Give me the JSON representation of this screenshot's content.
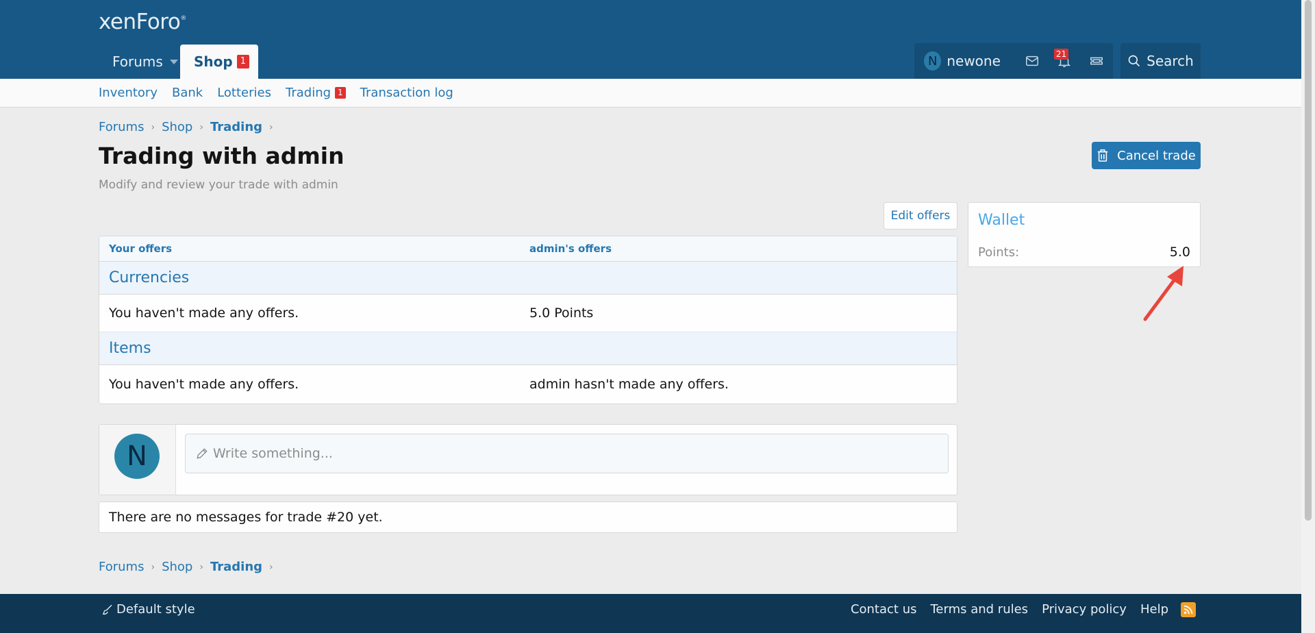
{
  "header": {
    "logo": "xenForo",
    "logo_mark": "®",
    "tabs": [
      {
        "label": "Forums"
      },
      {
        "label": "Shop",
        "badge": "1"
      }
    ],
    "user": {
      "initial": "N",
      "name": "newone"
    },
    "notifications_badge": "21",
    "search_label": "Search"
  },
  "subnav": {
    "items": [
      {
        "label": "Inventory"
      },
      {
        "label": "Bank"
      },
      {
        "label": "Lotteries"
      },
      {
        "label": "Trading",
        "badge": "1"
      },
      {
        "label": "Transaction log"
      }
    ]
  },
  "breadcrumb": {
    "items": [
      "Forums",
      "Shop",
      "Trading"
    ],
    "sep": "›"
  },
  "page": {
    "title": "Trading with admin",
    "description": "Modify and review your trade with admin",
    "cancel_label": "Cancel trade",
    "edit_label": "Edit offers"
  },
  "offers": {
    "headers": [
      "Your offers",
      "admin's offers"
    ],
    "sections": [
      {
        "title": "Currencies",
        "yours": "You haven't made any offers.",
        "theirs": "5.0 Points"
      },
      {
        "title": "Items",
        "yours": "You haven't made any offers.",
        "theirs": "admin hasn't made any offers."
      }
    ]
  },
  "wallet": {
    "title": "Wallet",
    "label": "Points:",
    "value": "5.0"
  },
  "composer": {
    "avatar_initial": "N",
    "placeholder": "Write something..."
  },
  "messages": {
    "empty_text": "There are no messages for trade #20 yet."
  },
  "footer": {
    "style_label": "Default style",
    "links": [
      "Contact us",
      "Terms and rules",
      "Privacy policy",
      "Help"
    ]
  },
  "colors": {
    "header": "#185886",
    "accent": "#2577b1",
    "badge": "#e03030",
    "footer": "#0f3652",
    "annotation_arrow": "#e8453c"
  }
}
